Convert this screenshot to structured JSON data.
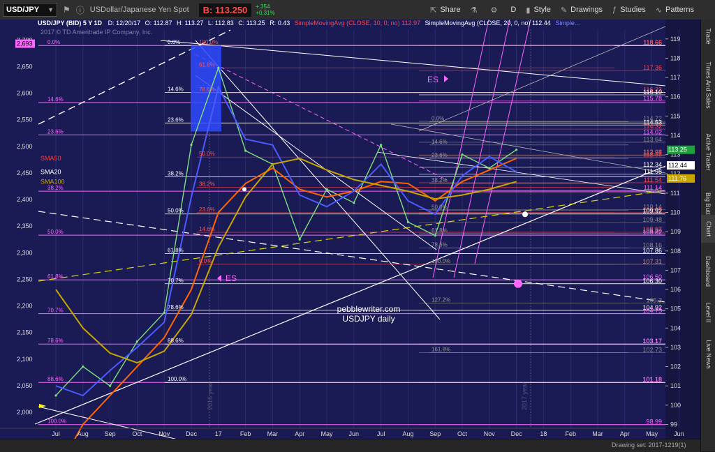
{
  "toolbar": {
    "symbol": "USD/JPY",
    "description": "USDollar/Japanese Yen Spot",
    "bid": "B: 113.250",
    "change": "+.354",
    "change_pct": "+0.31%",
    "share": "Share",
    "period": "D",
    "style": "Style",
    "drawings": "Drawings",
    "studies": "Studies",
    "patterns": "Patterns"
  },
  "sidebar": {
    "tabs": [
      "Trade",
      "Times And Sales",
      "Active Trader",
      "Big Buttons",
      "Chart",
      "Dashboard",
      "Level II",
      "Live News"
    ]
  },
  "colors": {
    "background": "#1a1a55",
    "sma50": "#ff6600",
    "sma20": "#4a5bff",
    "sma100": "#c8a600",
    "fib": "#ff66ff",
    "price_label": "#ff4444"
  },
  "header": {
    "title": "USD/JPY (BID) 5 Y 1D",
    "date": "D: 12/20/17",
    "ohlc": [
      "O: 112.87",
      "H: 113.27",
      "L: 112.83",
      "C: 113.25",
      "R: 0.43"
    ],
    "sma10": "SimpleMovingAvg (CLOSE, 10, 0, no)",
    "sma10_value": "112.97",
    "sma20": "SimpleMovingAvg (CLOSE, 20, 0, no)",
    "sma20_value": "112.44",
    "more": "Simple...",
    "copyright": "2017 © TD Ameritrade IP Company, Inc."
  },
  "chart_data": {
    "type": "line",
    "title": "USD/JPY (BID) 5 Y 1D",
    "x_ticks": [
      "Jul",
      "Aug",
      "Sep",
      "Oct",
      "Nov",
      "Dec",
      "17",
      "Feb",
      "Mar",
      "Apr",
      "May",
      "Jun",
      "Jul",
      "Aug",
      "Sep",
      "Oct",
      "Nov",
      "Dec",
      "18",
      "Feb",
      "Mar",
      "Apr",
      "May",
      "Jun"
    ],
    "right_axis": {
      "range": [
        98.8,
        119.5
      ],
      "ticks": [
        99,
        100,
        101,
        102,
        103,
        104,
        105,
        106,
        107,
        108,
        109,
        110,
        111,
        112,
        113,
        114,
        115,
        116,
        117,
        118,
        119
      ]
    },
    "left_axis": {
      "range": [
        1970,
        2720
      ],
      "ticks": [
        2000,
        2050,
        2100,
        2150,
        2200,
        2250,
        2300,
        2350,
        2400,
        2450,
        2500,
        2550,
        2600,
        2650,
        2700
      ],
      "marker": "2,693"
    },
    "price_boxes": [
      {
        "label": "113.25",
        "value": 113.25,
        "color": "#21a040"
      },
      {
        "label": "112.44",
        "value": 112.44,
        "color": "#ffffff"
      },
      {
        "label": "111.76",
        "value": 111.76,
        "color": "#c8a600"
      }
    ],
    "price_series": {
      "name": "USD/JPY",
      "x": [
        "Jul",
        "Aug",
        "Sep",
        "Oct",
        "Nov",
        "Dec",
        "17",
        "Feb",
        "Mar",
        "Apr",
        "May",
        "Jun",
        "Jul",
        "Aug",
        "Sep",
        "Oct",
        "Nov",
        "Dec"
      ],
      "values": [
        100.5,
        102.0,
        101.0,
        103.3,
        104.8,
        113.5,
        117.5,
        113.2,
        112.5,
        108.6,
        111.2,
        110.5,
        113.5,
        109.5,
        108.8,
        113.0,
        112.3,
        113.25
      ]
    },
    "sma_labels": [
      {
        "label": "SMA50",
        "value": 112.8,
        "color": "#ff3b3b"
      },
      {
        "label": "SMA20",
        "value": 112.1,
        "color": "#ffffff"
      },
      {
        "label": "SMA100",
        "value": 111.6,
        "color": "#c8a600"
      }
    ],
    "fib_left": [
      {
        "label": "0.0%",
        "value": 118.66
      },
      {
        "label": "14.6%",
        "value": 115.7
      },
      {
        "label": "23.6%",
        "value": 114.02
      },
      {
        "label": "38.2%",
        "value": 111.1
      },
      {
        "label": "50.0%",
        "value": 108.82
      },
      {
        "label": "61.8%",
        "value": 106.5
      },
      {
        "label": "70.7%",
        "value": 104.75
      },
      {
        "label": "78.6%",
        "value": 103.17
      },
      {
        "label": "88.6%",
        "value": 101.18
      },
      {
        "label": "100.0%",
        "value": 98.99
      }
    ],
    "fib_mid": [
      {
        "label": "0.0%",
        "value": 118.66
      },
      {
        "label": "14.6%",
        "value": 116.23
      },
      {
        "label": "23.6%",
        "value": 114.64
      },
      {
        "label": "38.2%",
        "value": 111.85
      },
      {
        "label": "50.0%",
        "value": 109.92
      },
      {
        "label": "61.8%",
        "value": 107.86
      },
      {
        "label": "70.7%",
        "value": 106.3
      },
      {
        "label": "78.6%",
        "value": 104.92
      },
      {
        "label": "88.6%",
        "value": 103.17
      },
      {
        "label": "100.0%",
        "value": 101.18
      }
    ],
    "fib_red": [
      {
        "label": "100.0%",
        "value": 118.66
      },
      {
        "label": "61.8%",
        "value": 117.5
      },
      {
        "label": "78.6%",
        "value": 116.2
      },
      {
        "label": "50.0%",
        "value": 112.87
      },
      {
        "label": "38.2%",
        "value": 111.3
      },
      {
        "label": "23.6%",
        "value": 109.99
      },
      {
        "label": "14.6%",
        "value": 108.97
      },
      {
        "label": "0.0%",
        "value": 107.31
      }
    ],
    "fib_gray": [
      {
        "label": "0.0%",
        "value": 114.7
      },
      {
        "label": "14.6%",
        "value": 113.5
      },
      {
        "label": "23.6%",
        "value": 112.8
      },
      {
        "label": "38.2%",
        "value": 111.5
      },
      {
        "label": "50.0%",
        "value": 110.1
      },
      {
        "label": "61.8%",
        "value": 108.9
      },
      {
        "label": "78.6%",
        "value": 108.16
      },
      {
        "label": "100.0%",
        "value": 107.31
      },
      {
        "label": "127.2%",
        "value": 105.3
      },
      {
        "label": "161.8%",
        "value": 102.73
      }
    ],
    "levels": [
      {
        "label": "118.66",
        "value": 118.66,
        "color": "#ffffff"
      },
      {
        "label": "118.66",
        "value": 118.66,
        "color": "#ff4444"
      },
      {
        "label": "117.36",
        "value": 117.36,
        "color": "#ff4444"
      },
      {
        "label": "116.23",
        "value": 116.23,
        "color": "#ff4444"
      },
      {
        "label": "116.10",
        "value": 116.1,
        "color": "#ffffff"
      },
      {
        "label": "115.78",
        "value": 115.78,
        "color": "#ff66ff"
      },
      {
        "label": "114.72",
        "value": 114.72,
        "color": "#888888"
      },
      {
        "label": "114.53",
        "value": 114.53,
        "color": "#ffffff"
      },
      {
        "label": "114.32",
        "value": 114.32,
        "color": "#ff4444"
      },
      {
        "label": "114.02",
        "value": 114.02,
        "color": "#ff66ff"
      },
      {
        "label": "113.64",
        "value": 113.64,
        "color": "#888888"
      },
      {
        "label": "112.98",
        "value": 112.98,
        "color": "#ff4444"
      },
      {
        "label": "112.97",
        "value": 112.97,
        "color": "#888888"
      },
      {
        "label": "112.86",
        "value": 112.86,
        "color": "#ff4444"
      },
      {
        "label": "112.34",
        "value": 112.34,
        "color": "#ffffff"
      },
      {
        "label": "111.98",
        "value": 111.98,
        "color": "#ffffff"
      },
      {
        "label": "111.54",
        "value": 111.54,
        "color": "#ff4444"
      },
      {
        "label": "111.14",
        "value": 111.14,
        "color": "#ff66ff"
      },
      {
        "label": "111.02",
        "value": 111.02,
        "color": "#888888"
      },
      {
        "label": "110.14",
        "value": 110.14,
        "color": "#888888"
      },
      {
        "label": "109.99",
        "value": 109.99,
        "color": "#ff4444"
      },
      {
        "label": "109.92",
        "value": 109.92,
        "color": "#ffffff"
      },
      {
        "label": "109.48",
        "value": 109.48,
        "color": "#888888"
      },
      {
        "label": "108.97",
        "value": 108.97,
        "color": "#ff4444"
      },
      {
        "label": "108.90",
        "value": 108.9,
        "color": "#888888"
      },
      {
        "label": "108.82",
        "value": 108.82,
        "color": "#ff66ff"
      },
      {
        "label": "108.16",
        "value": 108.16,
        "color": "#888888"
      },
      {
        "label": "107.86",
        "value": 107.86,
        "color": "#ffffff"
      },
      {
        "label": "107.31",
        "value": 107.31,
        "color": "#ff4444"
      },
      {
        "label": "107.31",
        "value": 107.31,
        "color": "#888888"
      },
      {
        "label": "106.50",
        "value": 106.5,
        "color": "#ff66ff"
      },
      {
        "label": "106.30",
        "value": 106.3,
        "color": "#ffffff"
      },
      {
        "label": "105.3",
        "value": 105.3,
        "color": "#888888"
      },
      {
        "label": "104.92",
        "value": 104.92,
        "color": "#ffffff"
      },
      {
        "label": "104.75",
        "value": 104.75,
        "color": "#ff66ff"
      },
      {
        "label": "103.17",
        "value": 103.17,
        "color": "#ffffff"
      },
      {
        "label": "103.17",
        "value": 103.17,
        "color": "#ff66ff"
      },
      {
        "label": "102.73",
        "value": 102.73,
        "color": "#888888"
      },
      {
        "label": "101.18",
        "value": 101.18,
        "color": "#ffffff"
      },
      {
        "label": "101.18",
        "value": 101.18,
        "color": "#ff66ff"
      },
      {
        "label": "98.99",
        "value": 98.99,
        "color": "#ff66ff"
      }
    ],
    "annotations": {
      "watermark": "pebblewriter.com",
      "subtitle": "USDJPY daily",
      "es_top": "ES",
      "es_bottom": "ES",
      "year_2016": "2016 year",
      "year_2017": "2017 year"
    }
  },
  "statusbar": {
    "drawing_set": "Drawing set: 2017-1219(1)"
  }
}
